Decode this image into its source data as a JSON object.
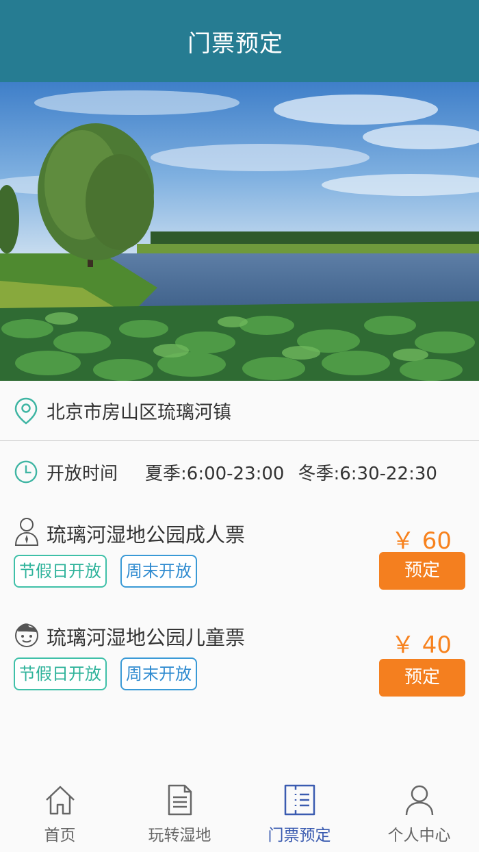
{
  "header": {
    "title": "门票预定"
  },
  "address": {
    "icon": "location-pin-icon",
    "text": "北京市房山区琉璃河镇"
  },
  "hours": {
    "icon": "clock-icon",
    "label": "开放时间",
    "summer": "夏季:6:00-23:00",
    "winter": "冬季:6:30-22:30"
  },
  "tickets": [
    {
      "icon": "adult-person-icon",
      "name": "琉璃河湿地公园成人票",
      "tags": [
        "节假日开放",
        "周末开放"
      ],
      "price": "￥ 60",
      "button": "预定"
    },
    {
      "icon": "child-face-icon",
      "name": "琉璃河湿地公园儿童票",
      "tags": [
        "节假日开放",
        "周末开放"
      ],
      "price": "￥ 40",
      "button": "预定"
    }
  ],
  "nav": {
    "items": [
      {
        "label": "首页",
        "icon": "home-icon",
        "active": false
      },
      {
        "label": "玩转湿地",
        "icon": "document-icon",
        "active": false
      },
      {
        "label": "门票预定",
        "icon": "ticket-icon",
        "active": true
      },
      {
        "label": "个人中心",
        "icon": "user-icon",
        "active": false
      }
    ]
  },
  "colors": {
    "header_bg": "#267c92",
    "accent_orange": "#f47f1f",
    "tag_green": "#3fc0a8",
    "tag_blue": "#3a9ad6",
    "nav_active": "#3a5bb0"
  }
}
